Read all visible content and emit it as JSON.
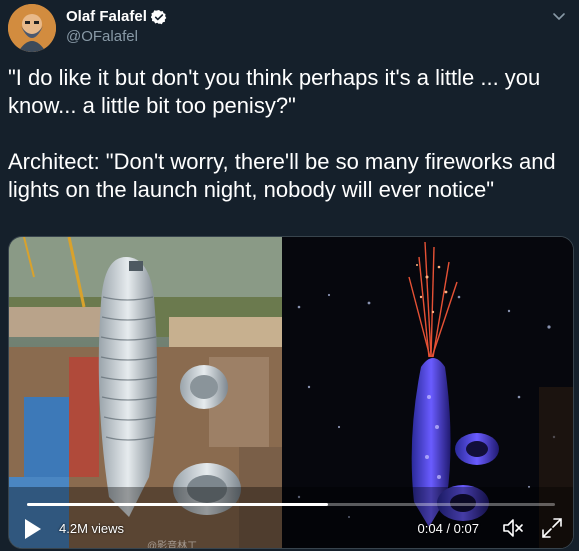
{
  "tweet": {
    "author_name": "Olaf Falafel",
    "handle": "@OFalafel",
    "text": "\"I do like it but don't you think perhaps it's a little ... you know... a little bit too penisy?\"\n\nArchitect: \"Don't worry, there'll be so many fireworks and lights on the launch night, nobody will ever notice\""
  },
  "icons": {
    "verified": "verified-badge-icon",
    "caret": "chevron-down-icon",
    "play": "play-icon",
    "mute": "volume-muted-icon",
    "fullscreen": "fullscreen-icon"
  },
  "video": {
    "views": "4.2M views",
    "time": "0:04 / 0:07",
    "progress": 0.57,
    "watermark": "@影音林工"
  },
  "colors": {
    "background": "#15202b",
    "secondary_text": "#8899a6",
    "verified": "#ffffff"
  }
}
